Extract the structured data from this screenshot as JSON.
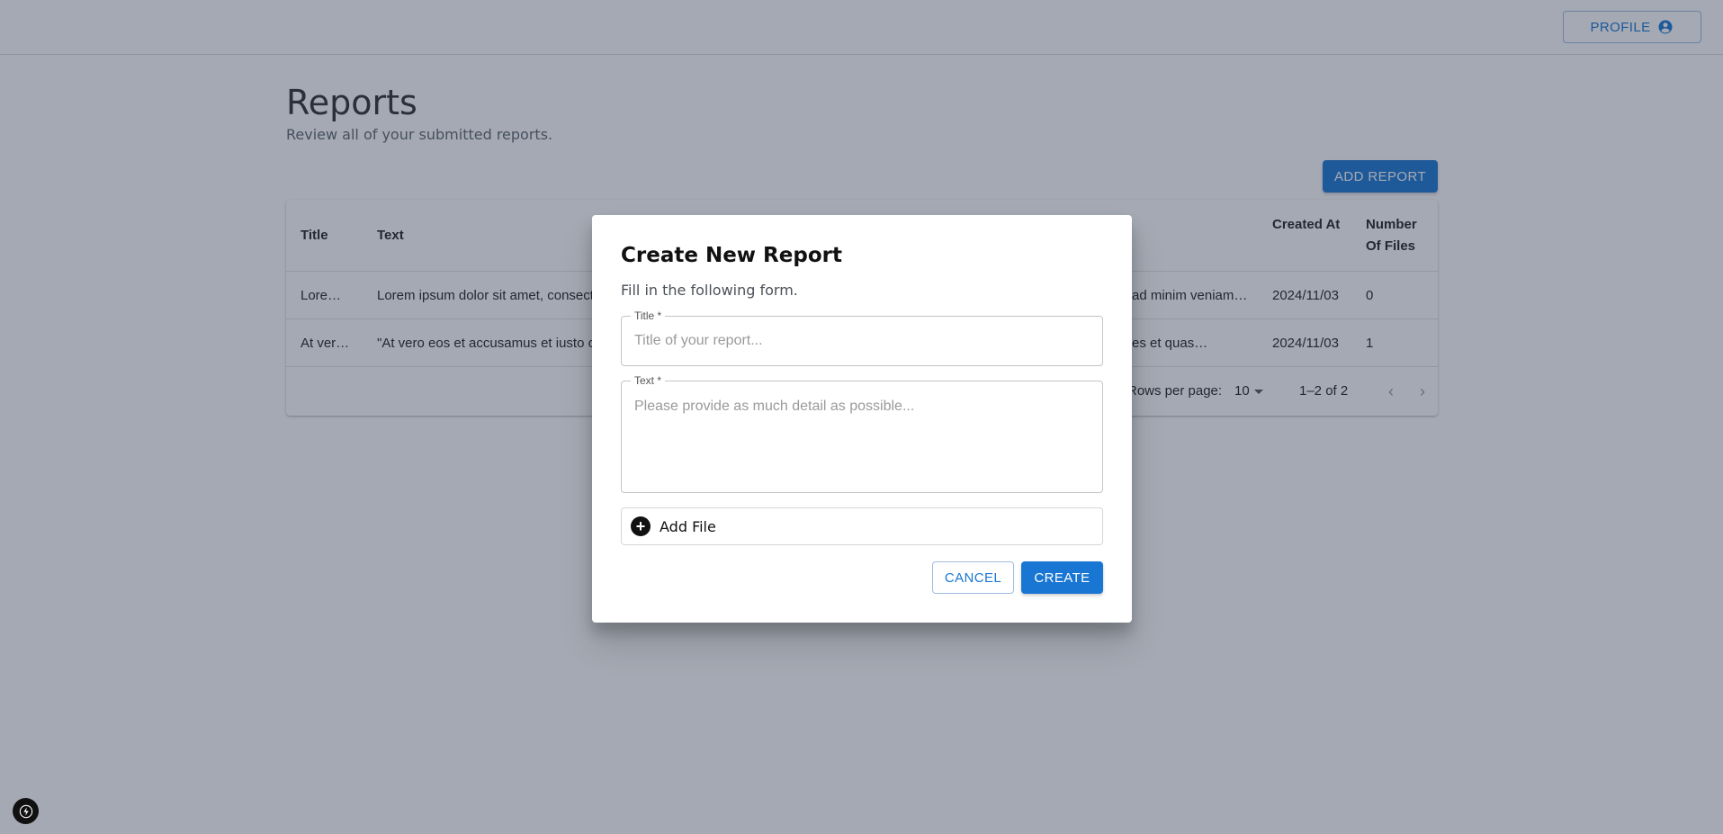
{
  "header": {
    "profile_label": "PROFILE",
    "profile_icon": "account-circle-icon"
  },
  "page": {
    "title": "Reports",
    "subtitle": "Review all of your submitted reports.",
    "add_report_label": "ADD REPORT"
  },
  "table": {
    "columns": {
      "title": "Title",
      "text": "Text",
      "created_at": "Created At",
      "number_of_files": "Number Of Files"
    },
    "rows": [
      {
        "title": "Lore…",
        "text_start": "Lorem ipsum dolor sit amet, consecte",
        "text_end": "ad minim veniam…",
        "created_at": "2024/11/03",
        "files": "0"
      },
      {
        "title": "At ver…",
        "text_start": "\"At vero eos et accusamus et iusto od",
        "text_end": "es et quas…",
        "created_at": "2024/11/03",
        "files": "1"
      }
    ],
    "pagination": {
      "rows_per_page_label": "Rows per page:",
      "rows_per_page_value": "10",
      "range": "1–2 of 2"
    }
  },
  "dialog": {
    "title": "Create New Report",
    "subtitle": "Fill in the following form.",
    "title_field": {
      "label": "Title *",
      "placeholder": "Title of your report...",
      "value": ""
    },
    "text_field": {
      "label": "Text *",
      "placeholder": "Please provide as much detail as possible...",
      "value": ""
    },
    "add_file_label": "Add File",
    "cancel_label": "CANCEL",
    "create_label": "CREATE"
  },
  "colors": {
    "primary": "#1976d2",
    "backdrop": "rgba(38,50,74,0.42)"
  }
}
